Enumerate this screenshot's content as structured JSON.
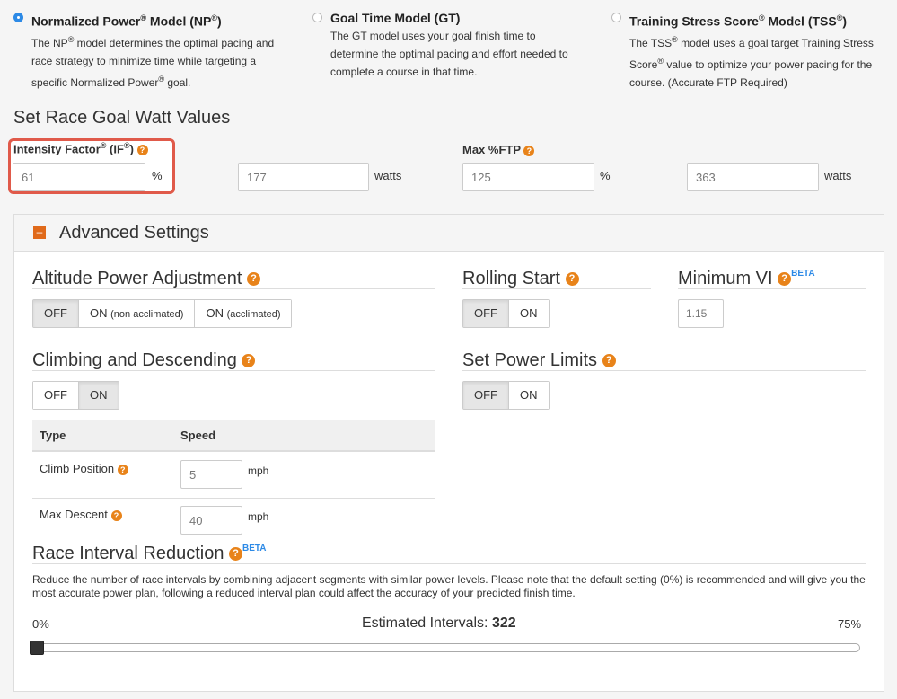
{
  "models": {
    "np": {
      "selected": true,
      "title_pre": "Normalized Power",
      "title_mid": " Model (NP",
      "title_post": ")",
      "desc_pre": "The NP",
      "desc_post": " model determines the optimal pacing and race strategy to minimize time while targeting a specific Normalized Power",
      "desc_end": " goal."
    },
    "gt": {
      "selected": false,
      "title": "Goal Time Model (GT)",
      "desc": "The GT model uses your goal finish time to determine the optimal pacing and effort needed to complete a course in that time."
    },
    "tss": {
      "selected": false,
      "title_pre": "Training Stress Score",
      "title_mid": " Model (TSS",
      "title_post": ")",
      "desc_pre": "The TSS",
      "desc_mid": " model uses a goal target Training Stress Score",
      "desc_post": " value to optimize your power pacing for the course. (Accurate FTP Required)"
    },
    "reg": "®"
  },
  "goal": {
    "section_title": "Set Race Goal Watt Values",
    "if_label_pre": "Intensity Factor",
    "if_label_mid": " (IF",
    "if_label_post": ")",
    "if_value": "61",
    "if_unit": "%",
    "if_watts": "177",
    "watts_unit": "watts",
    "ftp_label": "Max %FTP",
    "ftp_value": "125",
    "ftp_unit": "%",
    "ftp_watts": "363"
  },
  "advanced": {
    "title": "Advanced Settings",
    "collapse_symbol": "–",
    "altitude": {
      "title": "Altitude Power Adjustment",
      "off": "OFF",
      "on_non_main": "ON",
      "on_non_sub": "(non acclimated)",
      "on_acc_main": "ON",
      "on_acc_sub": "(acclimated)",
      "active": "off"
    },
    "rolling": {
      "title": "Rolling Start",
      "off": "OFF",
      "on": "ON",
      "active": "off"
    },
    "minvi": {
      "title": "Minimum VI",
      "beta": "BETA",
      "value": "1.15"
    },
    "climbing": {
      "title": "Climbing and Descending",
      "off": "OFF",
      "on": "ON",
      "active": "on",
      "table": {
        "col_type": "Type",
        "col_speed": "Speed",
        "rows": [
          {
            "label": "Climb Position",
            "value": "5",
            "unit": "mph"
          },
          {
            "label": "Max Descent",
            "value": "40",
            "unit": "mph"
          }
        ]
      }
    },
    "power_limits": {
      "title": "Set Power Limits",
      "off": "OFF",
      "on": "ON",
      "active": "off"
    },
    "interval": {
      "title": "Race Interval Reduction",
      "beta": "BETA",
      "desc": "Reduce the number of race intervals by combining adjacent segments with similar power levels. Please note that the default setting (0%) is recommended and will give you the most accurate power plan, following a reduced interval plan could affect the accuracy of your predicted finish time.",
      "min_label": "0%",
      "max_label": "75%",
      "estimated_label": "Estimated Intervals:",
      "estimated_value": "322",
      "slider_value": 0
    }
  },
  "help_symbol": "?",
  "colors": {
    "accent": "#e8831a",
    "link": "#2d8ae6",
    "highlight": "#e05a4a"
  }
}
